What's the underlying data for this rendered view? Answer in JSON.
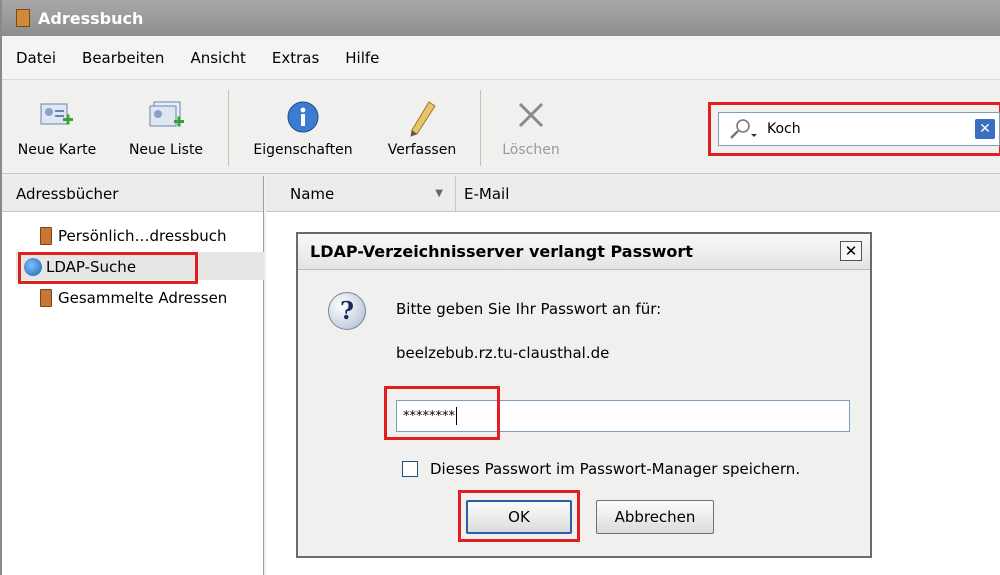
{
  "window": {
    "title": "Adressbuch"
  },
  "menu": [
    "Datei",
    "Bearbeiten",
    "Ansicht",
    "Extras",
    "Hilfe"
  ],
  "toolbar": {
    "new_card": "Neue Karte",
    "new_list": "Neue Liste",
    "properties": "Eigenschaften",
    "compose": "Verfassen",
    "delete": "Löschen"
  },
  "search": {
    "value": "Koch",
    "clear": "✕"
  },
  "sidebar": {
    "header": "Adressbücher",
    "items": [
      {
        "label": "Persönlich…dressbuch"
      },
      {
        "label": "LDAP-Suche"
      },
      {
        "label": "Gesammelte Adressen"
      }
    ]
  },
  "columns": {
    "name": "Name",
    "email": "E-Mail"
  },
  "dialog": {
    "title": "LDAP-Verzeichnisserver verlangt Passwort",
    "close": "✕",
    "icon": "?",
    "prompt": "Bitte geben Sie Ihr Passwort an für:",
    "host": "beelzebub.rz.tu-clausthal.de",
    "password_mask": "********",
    "save_label": "Dieses Passwort im Passwort-Manager speichern.",
    "ok": "OK",
    "cancel": "Abbrechen"
  },
  "colors": {
    "highlight": "#e02020",
    "accent": "#2a5fa8"
  }
}
